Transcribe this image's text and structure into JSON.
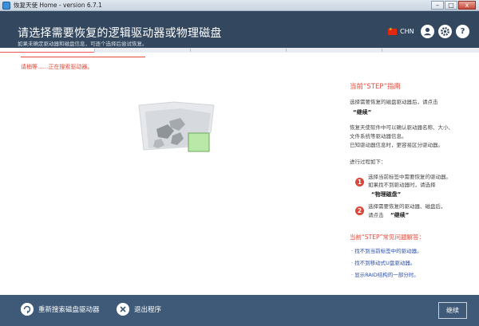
{
  "window": {
    "title": "恢复天使 Home - version 6.7.1",
    "buttons": {
      "minimize": "–",
      "maximize": "□",
      "close": "x"
    }
  },
  "header": {
    "title": "请选择需要恢复的逻辑驱动器或物理磁盘",
    "subtitle": "如果未确定驱动器和磁盘信息，可逐个选择后尝试恢复。",
    "language": "CHN",
    "user_icon": "user-icon",
    "settings_icon": "gear-icon",
    "help_icon": "?"
  },
  "main": {
    "status": "请稍等......正在搜索驱动器。"
  },
  "guide": {
    "heading": "当前“STEP”指南",
    "intro": "选择需要恢复的磁盘驱动器后，请点击",
    "continue_quote": "“继续”",
    "para_line1": "恢复天使软件中可以确认驱动器名称、大小、",
    "para_line2": "文件系统等驱动器信息。",
    "para_line3": "已知驱动器信息时，更容易区分驱动器。",
    "process_label": "进行过程如下：",
    "step1_num": "1",
    "step1_line1": "选择当前标签中需要恢复的驱动器。",
    "step1_line2": "如果找不到驱动器时，请选择",
    "step1_quote": "“物理磁盘”",
    "step2_num": "2",
    "step2_line1": "选择需要恢复的驱动器、磁盘后，",
    "step2_line2": "请点击",
    "step2_quote": "“继续”",
    "faq_heading": "当前“STEP”常见问题解答：",
    "faq": [
      "· 找不到当前标签中的驱动器。",
      "· 找不到移动式U盘驱动器。",
      "· 显示RAID结构的一部分时。"
    ]
  },
  "footer": {
    "rescan": "重新搜索磁盘驱动器",
    "exit": "退出程序",
    "continue": "继续"
  },
  "colors": {
    "header_bg": "#33475e",
    "footer_bg": "#3f5a78",
    "accent_red": "#e34a3a",
    "link_blue": "#2b4fa8"
  }
}
